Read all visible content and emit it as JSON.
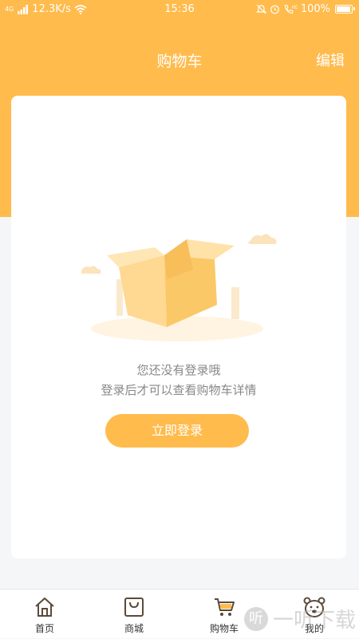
{
  "status_bar": {
    "network_type": "4G",
    "speed": "12.3K/s",
    "time": "15:36",
    "battery": "100%",
    "battery_level": 1.0,
    "icons": [
      "signal-icon",
      "wifi-icon",
      "mute-icon",
      "alarm-icon",
      "hd-call-icon",
      "battery-icon"
    ]
  },
  "header": {
    "title": "购物车",
    "edit_label": "编辑"
  },
  "empty_state": {
    "line1": "您还没有登录哦",
    "line2": "登录后才可以查看购物车详情",
    "login_button": "立即登录",
    "illustration": "empty-box-icon"
  },
  "tabs": [
    {
      "label": "首页",
      "icon": "home-icon",
      "active": false
    },
    {
      "label": "商城",
      "icon": "shop-bag-icon",
      "active": false
    },
    {
      "label": "购物车",
      "icon": "cart-icon",
      "active": true
    },
    {
      "label": "我的",
      "icon": "bear-face-icon",
      "active": false
    }
  ],
  "watermark": {
    "text": "一听下载",
    "badge": "听"
  },
  "colors": {
    "accent": "#ffbb4c",
    "background": "#f5f6f8",
    "card": "#ffffff",
    "text_muted": "#888888",
    "tab_text": "#333333",
    "icon_stroke": "#5a4a3a"
  }
}
